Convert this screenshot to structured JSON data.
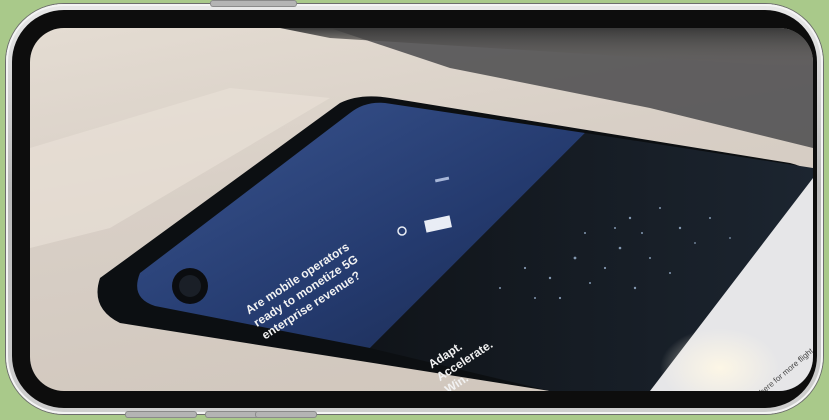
{
  "photo": {
    "headline_line1": "Are mobile operators",
    "headline_line2": "ready to monetize 5G",
    "headline_line3": "enterprise revenue?",
    "tagline_line1": "Adapt.",
    "tagline_line2": "Accelerate.",
    "tagline_line3": "Win.",
    "caption": "ut there for more flight"
  },
  "colors": {
    "background": "#a9c98a",
    "phone_screen_blue": "#243a6e",
    "phone_dark": "#0e1216",
    "table": "#dcd2c8"
  }
}
